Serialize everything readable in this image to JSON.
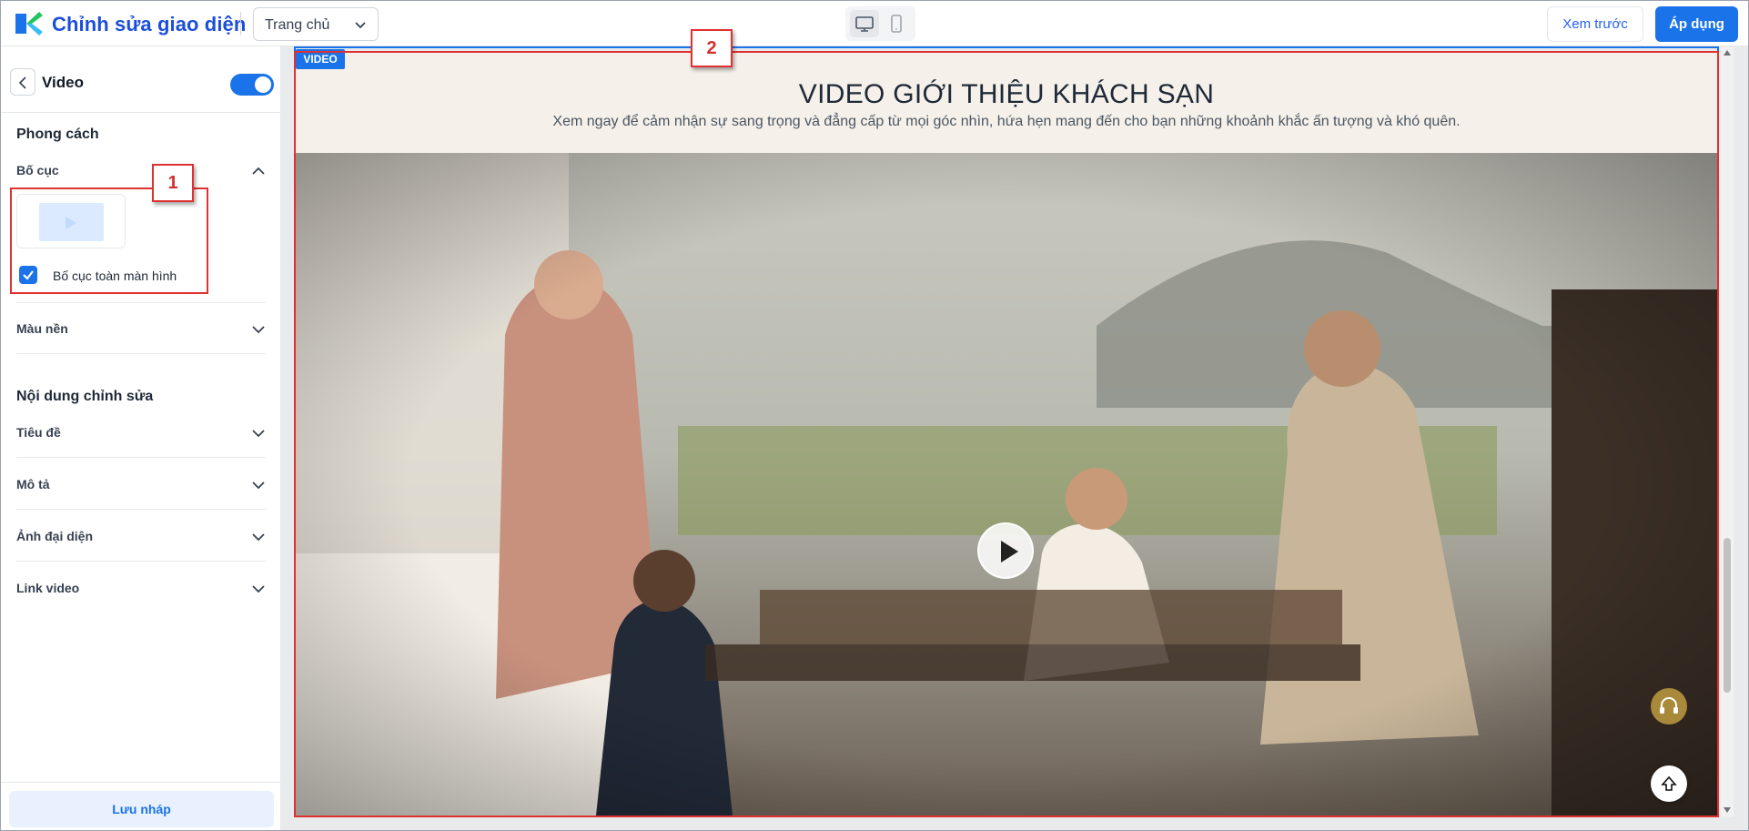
{
  "topbar": {
    "app_title": "Chỉnh sửa giao diện",
    "page_select": "Trang chủ",
    "preview_label": "Xem trước",
    "apply_label": "Áp dụng",
    "brand_color": "#1a73e8"
  },
  "sidebar": {
    "title": "Video",
    "enabled": true,
    "style_section": "Phong cách",
    "layout_label": "Bố cục",
    "fullscreen_label": "Bố cục toàn màn hình",
    "fullscreen_checked": true,
    "bg_color_label": "Màu nền",
    "content_section": "Nội dung chỉnh sửa",
    "content_items": [
      {
        "label": "Tiêu đề"
      },
      {
        "label": "Mô tả"
      },
      {
        "label": "Ảnh đại diện"
      },
      {
        "label": "Link video"
      }
    ],
    "save_draft_label": "Lưu nháp"
  },
  "annotations": [
    "1",
    "2"
  ],
  "canvas": {
    "section_tag": "VIDEO",
    "video_title": "VIDEO GIỚI THIỆU KHÁCH SẠN",
    "video_description": "Xem ngay để cảm nhận sự sang trọng và đẳng cấp từ mọi góc nhìn, hứa hẹn mang đến cho bạn những khoảnh khắc ấn tượng và khó quên."
  },
  "icons": [
    "logo-icon",
    "chevron-down-icon",
    "desktop-icon",
    "mobile-icon",
    "chevron-left-icon",
    "check-icon",
    "play-icon",
    "headset-icon",
    "arrow-up-icon"
  ]
}
